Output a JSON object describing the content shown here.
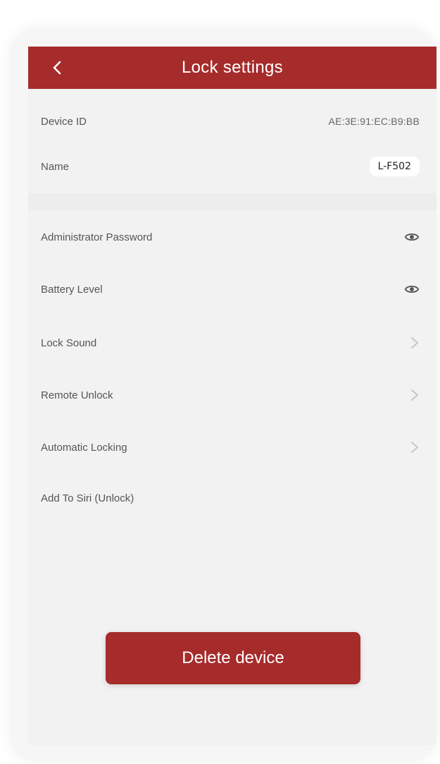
{
  "header": {
    "title": "Lock settings"
  },
  "rows": {
    "device_id": {
      "label": "Device ID",
      "value": "AE:3E:91:EC:B9:BB"
    },
    "name": {
      "label": "Name",
      "value": "L-F502"
    },
    "admin_password": {
      "label": "Administrator Password",
      "icon": "eye-icon"
    },
    "battery": {
      "label": "Battery Level",
      "icon": "eye-icon"
    },
    "lock_sound": {
      "label": "Lock Sound",
      "icon": "chevron-right-icon"
    },
    "remote_unlock": {
      "label": "Remote Unlock",
      "icon": "chevron-right-icon"
    },
    "automatic_locking": {
      "label": "Automatic Locking",
      "icon": "chevron-right-icon"
    },
    "add_to_siri": {
      "label": "Add To Siri (Unlock)"
    }
  },
  "actions": {
    "delete_label": "Delete device"
  },
  "colors": {
    "brand": "#a62b2b",
    "background": "#f2f2f2"
  }
}
